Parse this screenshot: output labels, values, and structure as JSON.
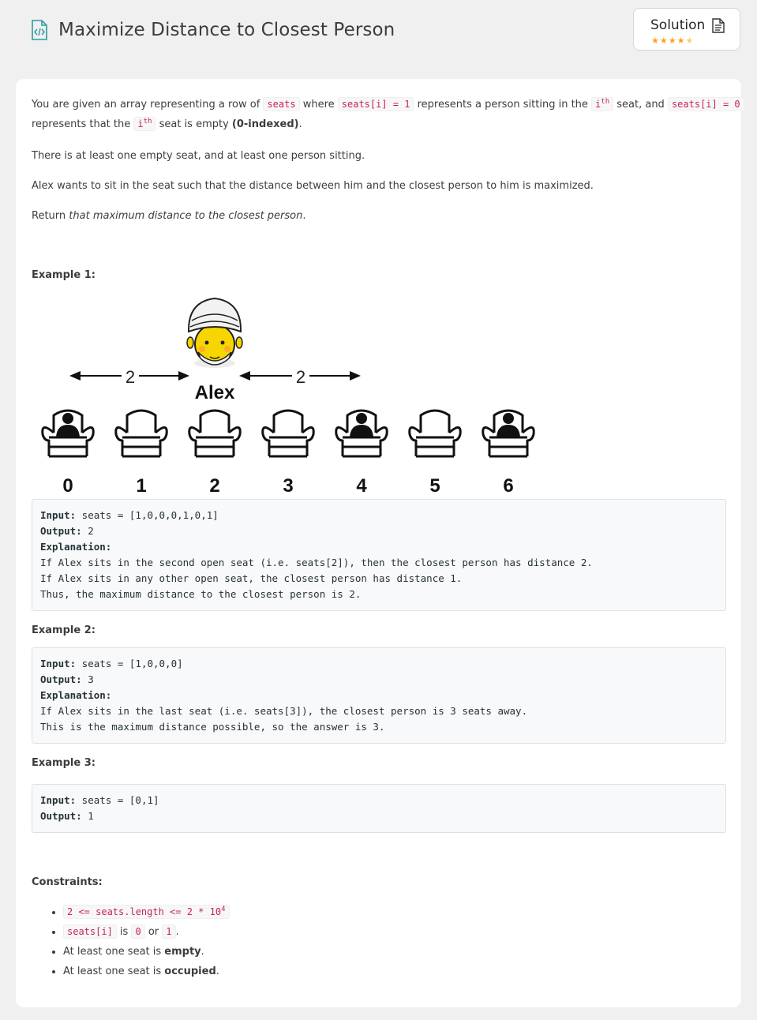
{
  "header": {
    "title": "Maximize Distance to Closest Person",
    "solution_label": "Solution",
    "rating_stars": 4.5
  },
  "problem": {
    "p1_a": "You are given an array representing a row of ",
    "p1_code1": "seats",
    "p1_b": " where ",
    "p1_code2": "seats[i] = 1",
    "p1_c": " represents a person sitting in the ",
    "p1_code3": "i",
    "p1_sup1": "th",
    "p1_d": " seat, and ",
    "p1_code4": "seats[i] = 0",
    "p1_e": "represents that the ",
    "p1_code5": "i",
    "p1_sup2": "th",
    "p1_f": " seat is empty ",
    "p1_bold": "(0-indexed)",
    "p1_g": ".",
    "p2": "There is at least one empty seat, and at least one person sitting.",
    "p3": "Alex wants to sit in the seat such that the distance between him and the closest person to him is maximized.",
    "p4_a": "Return ",
    "p4_italic": "that maximum distance to the closest person",
    "p4_b": "."
  },
  "diagram": {
    "name_label": "Alex",
    "distance_left": "2",
    "distance_right": "2",
    "seat_numbers": [
      "0",
      "1",
      "2",
      "3",
      "4",
      "5",
      "6"
    ],
    "seats": [
      1,
      0,
      0,
      0,
      1,
      0,
      1
    ]
  },
  "examples": [
    {
      "heading": "Example 1:",
      "input_label": "Input:",
      "input_value": " seats = [1,0,0,0,1,0,1]",
      "output_label": "Output:",
      "output_value": " 2",
      "explanation_label": "Explanation:",
      "explanation": "If Alex sits in the second open seat (i.e. seats[2]), then the closest person has distance 2.\nIf Alex sits in any other open seat, the closest person has distance 1.\nThus, the maximum distance to the closest person is 2."
    },
    {
      "heading": "Example 2:",
      "input_label": "Input:",
      "input_value": " seats = [1,0,0,0]",
      "output_label": "Output:",
      "output_value": " 3",
      "explanation_label": "Explanation:",
      "explanation": "If Alex sits in the last seat (i.e. seats[3]), the closest person is 3 seats away.\nThis is the maximum distance possible, so the answer is 3."
    },
    {
      "heading": "Example 3:",
      "input_label": "Input:",
      "input_value": " seats = [0,1]",
      "output_label": "Output:",
      "output_value": " 1"
    }
  ],
  "constraints": {
    "heading": "Constraints:",
    "c1_code": "2 <= seats.length <= 2 * 10",
    "c1_sup": "4",
    "c2_code1": "seats[i]",
    "c2_text1": " is ",
    "c2_code2": "0",
    "c2_text2": " or ",
    "c2_code3": "1",
    "c2_text3": ".",
    "c3_a": "At least one seat is ",
    "c3_bold": "empty",
    "c3_b": ".",
    "c4_a": "At least one seat is ",
    "c4_bold": "occupied",
    "c4_b": "."
  },
  "colors": {
    "accent": "#ffa116",
    "code_text": "#c7254e",
    "icon_teal": "#2e9c9c"
  }
}
